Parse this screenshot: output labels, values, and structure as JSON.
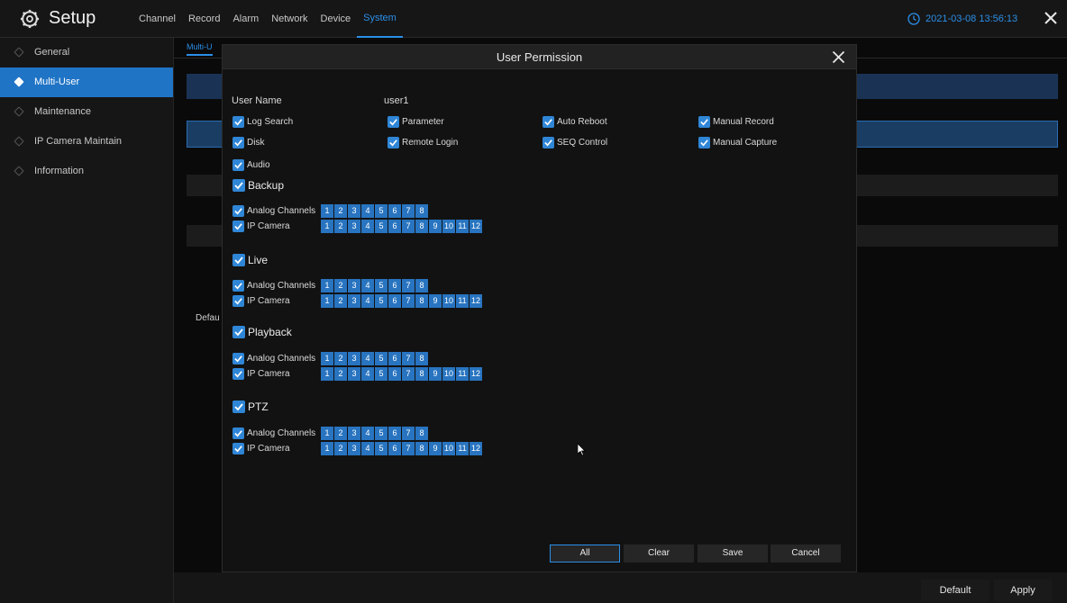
{
  "header": {
    "app_title": "Setup",
    "tabs": [
      "Channel",
      "Record",
      "Alarm",
      "Network",
      "Device",
      "System"
    ],
    "active_tab": "System",
    "datetime": "2021-03-08 13:56:13"
  },
  "sidebar": {
    "items": [
      {
        "label": "General"
      },
      {
        "label": "Multi-User",
        "active": true
      },
      {
        "label": "Maintenance"
      },
      {
        "label": "IP Camera Maintain"
      },
      {
        "label": "Information"
      }
    ]
  },
  "background": {
    "tab_label": "Multi-U",
    "default_partial": "Defau",
    "buttons": {
      "default": "Default",
      "apply": "Apply"
    }
  },
  "dialog": {
    "title": "User Permission",
    "user_name_label": "User Name",
    "user_name_value": "user1",
    "general_permissions": [
      {
        "label": "Log Search",
        "checked": true
      },
      {
        "label": "Parameter",
        "checked": true
      },
      {
        "label": "Auto Reboot",
        "checked": true
      },
      {
        "label": "Manual Record",
        "checked": true
      },
      {
        "label": "Disk",
        "checked": true
      },
      {
        "label": "Remote Login",
        "checked": true
      },
      {
        "label": "SEQ Control",
        "checked": true
      },
      {
        "label": "Manual Capture",
        "checked": true
      },
      {
        "label": "Audio",
        "checked": true
      }
    ],
    "sections": [
      {
        "label": "Backup",
        "checked": true,
        "analog_label": "Analog Channels",
        "ip_label": "IP Camera"
      },
      {
        "label": "Live",
        "checked": true,
        "analog_label": "Analog Channels",
        "ip_label": "IP Camera"
      },
      {
        "label": "Playback",
        "checked": true,
        "analog_label": "Analog Channels",
        "ip_label": "IP Camera"
      },
      {
        "label": "PTZ",
        "checked": true,
        "analog_label": "Analog Channels",
        "ip_label": "IP Camera"
      }
    ],
    "analog_channels": [
      "1",
      "2",
      "3",
      "4",
      "5",
      "6",
      "7",
      "8"
    ],
    "ip_channels": [
      "1",
      "2",
      "3",
      "4",
      "5",
      "6",
      "7",
      "8",
      "9",
      "10",
      "11",
      "12"
    ],
    "buttons": {
      "all": "All",
      "clear": "Clear",
      "save": "Save",
      "cancel": "Cancel"
    }
  },
  "colors": {
    "accent": "#2b8fe8",
    "checkbox": "#2f86d6",
    "channel": "#2874c0",
    "active_sidebar": "#1f74c6"
  }
}
